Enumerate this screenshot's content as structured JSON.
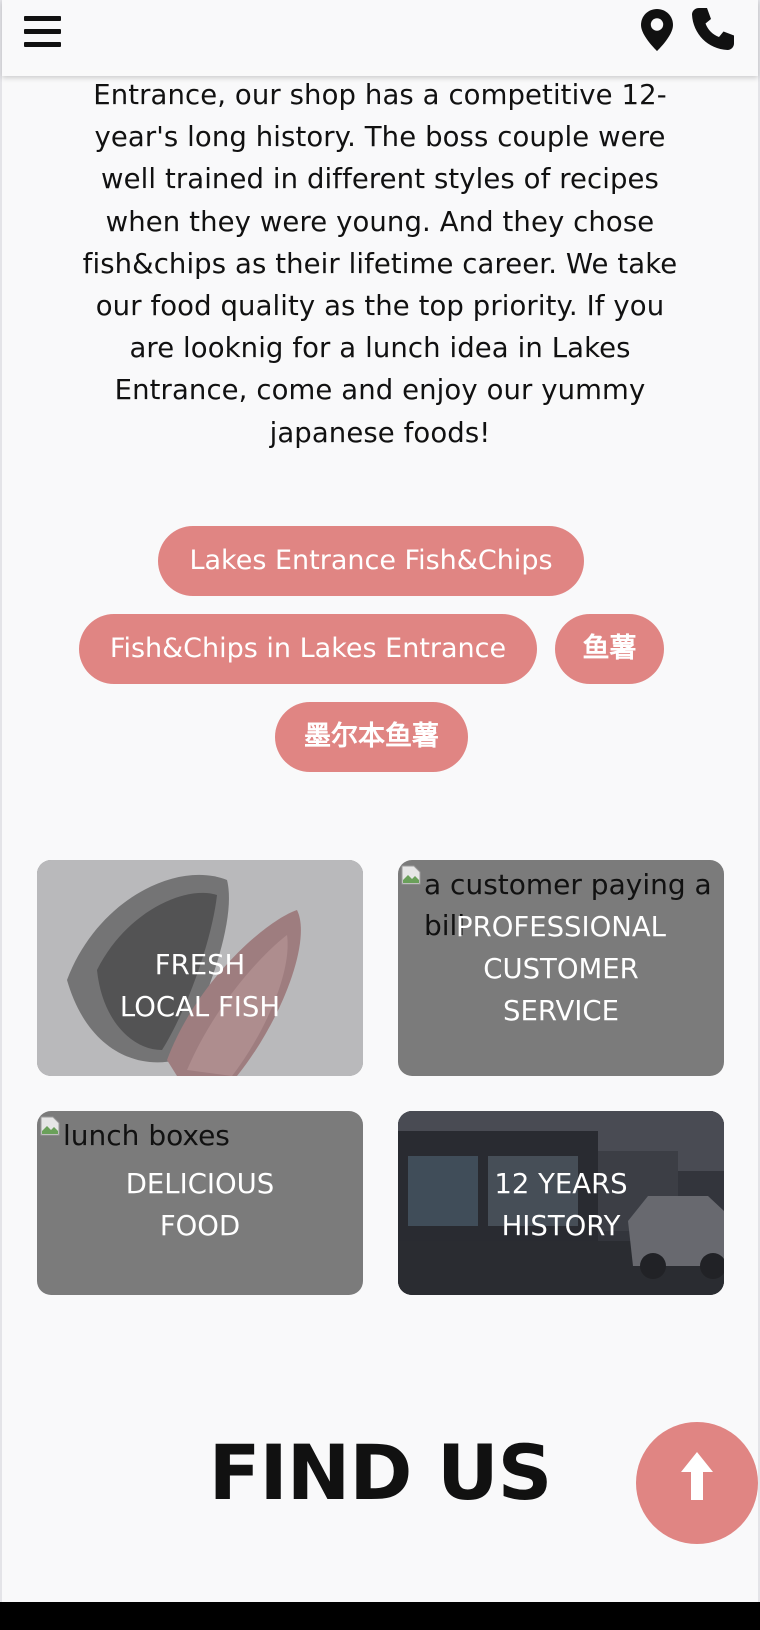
{
  "header": {
    "menu_icon": "hamburger-menu-icon",
    "location_icon": "map-pin-icon",
    "phone_icon": "phone-icon"
  },
  "intro": {
    "text": "Entrance, our shop has a competitive 12-year's long history. The boss couple were well trained in different styles of recipes when they were young. And they chose fish&chips as their lifetime career. We take our food quality as the top priority. If you are looknig for a lunch idea in Lakes Entrance, come and enjoy our yummy japanese foods!"
  },
  "tags": [
    "Lakes Entrance Fish&Chips",
    "Fish&Chips in Lakes Entrance",
    "鱼薯",
    "墨尔本鱼薯"
  ],
  "cards": [
    {
      "label_line1": "FRESH",
      "label_line2": "LOCAL FISH",
      "image": "fish fillets on ice"
    },
    {
      "alt": "a customer paying a bill",
      "label_line1": "PROFESSIONAL",
      "label_line2": "CUSTOMER",
      "label_line3": "SERVICE"
    },
    {
      "alt": "lunch boxes",
      "label_line1": "DELICIOUS",
      "label_line2": "FOOD"
    },
    {
      "label_line1": "12 YEARS",
      "label_line2": "HISTORY",
      "image": "shop front street view"
    }
  ],
  "find_us": {
    "title": "FIND US"
  },
  "back_to_top": {
    "icon": "arrow-up-icon"
  },
  "colors": {
    "accent": "#e08583",
    "card_overlay": "#7b7b7b",
    "background": "#f9f9fa",
    "footer": "#000000"
  }
}
